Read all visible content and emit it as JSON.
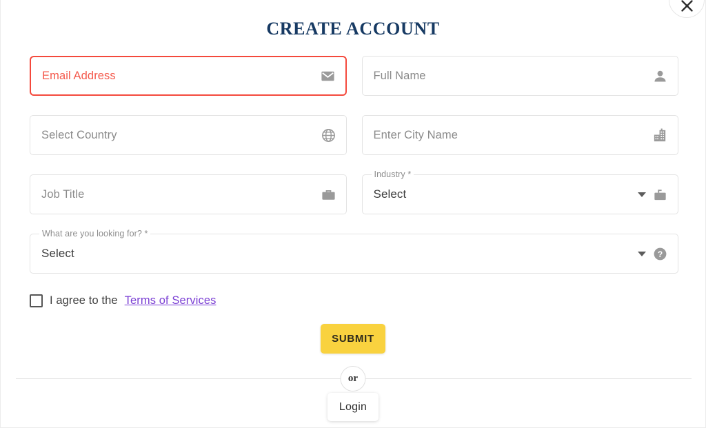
{
  "dialog": {
    "title": "CREATE ACCOUNT",
    "close_label": "×"
  },
  "colors": {
    "title": "#173a63",
    "error_border": "#f4493c",
    "error_text": "#f4594c",
    "submit_bg": "#f9d23f",
    "link": "#7b3fd4",
    "field_border": "#e3e3e3",
    "icon": "#999999"
  },
  "form": {
    "fields": [
      {
        "id": "email",
        "placeholder": "Email Address",
        "value": "",
        "icon": "envelope-icon",
        "state": "error",
        "label": "",
        "has_caret": false
      },
      {
        "id": "full_name",
        "placeholder": "Full Name",
        "value": "",
        "icon": "person-icon",
        "state": "normal",
        "label": "",
        "has_caret": false
      },
      {
        "id": "country",
        "placeholder": "Select Country",
        "value": "",
        "icon": "globe-icon",
        "state": "normal",
        "label": "",
        "has_caret": false
      },
      {
        "id": "city",
        "placeholder": "Enter City Name",
        "value": "",
        "icon": "building-icon",
        "state": "normal",
        "label": "",
        "has_caret": false
      },
      {
        "id": "job_title",
        "placeholder": "Job Title",
        "value": "",
        "icon": "briefcase-icon",
        "state": "normal",
        "label": "",
        "has_caret": false
      },
      {
        "id": "industry",
        "placeholder": "",
        "value": "Select",
        "icon": "briefcase-icon",
        "state": "normal",
        "label": "Industry *",
        "has_caret": true
      },
      {
        "id": "looking_for",
        "placeholder": "",
        "value": "Select",
        "icon": "question-circle-icon",
        "state": "normal",
        "label": "What are you looking for? *",
        "has_caret": true
      }
    ]
  },
  "agreement": {
    "checked": false,
    "text": "I agree to the",
    "link_text": "Terms of Services"
  },
  "actions": {
    "submit_label": "SUBMIT",
    "or_label": "or",
    "login_label": "Login"
  }
}
